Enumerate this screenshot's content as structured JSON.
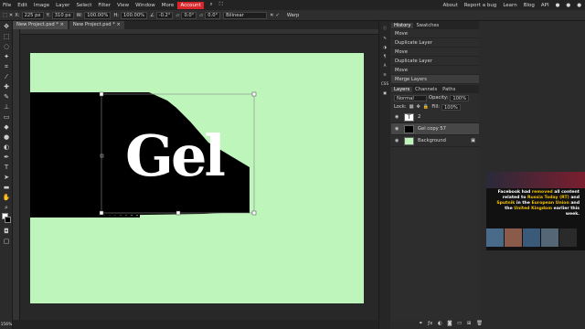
{
  "menubar": {
    "items": [
      "File",
      "Edit",
      "Image",
      "Layer",
      "Select",
      "Filter",
      "View",
      "Window",
      "More",
      "Account"
    ],
    "right": [
      "About",
      "Report a bug",
      "Learn",
      "Blog",
      "API"
    ]
  },
  "tool_options": {
    "x_label": "X:",
    "x_value": "225 px",
    "y_label": "Y:",
    "y_value": "310 px",
    "w_label": "W:",
    "w_value": "100.00%",
    "h_label": "H:",
    "h_value": "100.00%",
    "rot1": "-0.2°",
    "rot2": "0.0°",
    "rot3": "0.0°",
    "interp": "Bilinear",
    "warp": "Warp"
  },
  "doc_tabs": [
    "New Project.psd *",
    "New Project.psd *"
  ],
  "status": {
    "zoom": "156%"
  },
  "side_buttons": [
    "CSS"
  ],
  "history": {
    "tabs": [
      "History",
      "Swatches"
    ],
    "items": [
      "Move",
      "Duplicate Layer",
      "Move",
      "Duplicate Layer",
      "Move",
      "Merge Layers"
    ]
  },
  "layers": {
    "tabs": [
      "Layers",
      "Channels",
      "Paths"
    ],
    "blend": "Normal",
    "opacity_label": "Opacity:",
    "opacity": "100%",
    "lock_label": "Lock:",
    "fill_label": "Fill:",
    "fill": "100%",
    "items": [
      {
        "name": "2"
      },
      {
        "name": "Gel copy 57"
      },
      {
        "name": "Background"
      }
    ]
  },
  "canvas": {
    "text": "Gel",
    "bg_color": "#bef5bb"
  },
  "ad": {
    "p1": "Facebook had ",
    "h1": "removed",
    "p2": " all content related to ",
    "h2": "Russia Today (RT)",
    "p3": " and ",
    "h3": "Sputnik",
    "p4": " in the ",
    "h4": "European Union",
    "p5": " and the ",
    "h5": "United Kingdom",
    "p6": " earlier this week."
  }
}
